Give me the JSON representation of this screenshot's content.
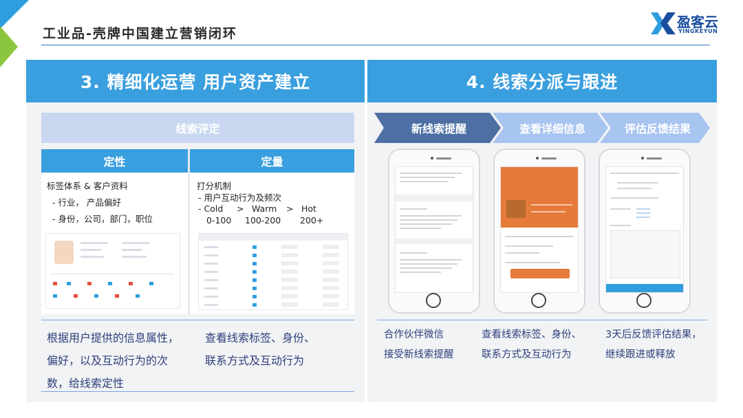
{
  "header": {
    "title": "工业品-壳牌中国建立营销闭环"
  },
  "logo": {
    "name": "盈客云",
    "sub": "YINGKEYUN"
  },
  "left_panel": {
    "heading": "3. 精细化运营 用户资产建立",
    "eval_bar": "线索评定",
    "qualitative": {
      "heading": "定性",
      "lines": [
        "标签体系 & 客户资料",
        "- 行业，  产品偏好",
        "- 身份，公司，部门，职位"
      ]
    },
    "quantitative": {
      "heading": "定量",
      "lines": [
        "打分机制",
        "- 用户互动行为及频次"
      ],
      "levels": [
        "- Cold",
        ">",
        "Warm",
        ">",
        "Hot"
      ],
      "ranges": [
        "0-100",
        "100-200",
        "200+"
      ]
    },
    "desc_left": [
      "根据用户提供的信息属性，",
      "偏好，以及互动行为的次",
      "数，给线索定性"
    ],
    "desc_right": [
      "查看线索标签、身份、",
      "联系方式及互动行为"
    ]
  },
  "right_panel": {
    "heading": "4. 线索分派与跟进",
    "steps": [
      "新线索提醒",
      "查看详细信息",
      "评估反馈结果"
    ],
    "colors": {
      "step_active": "#4d6fa3",
      "step_inactive": "#a8c4f0"
    },
    "desc": [
      [
        "合作伙伴微信",
        "接受新线索提醒"
      ],
      [
        "查看线索标签、身份、",
        "联系方式及互动行为"
      ],
      [
        "3天后反馈评估结果，",
        "继续跟进或释放"
      ]
    ]
  },
  "colors": {
    "accent": "#3a9fde",
    "bar_light": "#c9d7f1",
    "desc_text": "#2e3f7a"
  }
}
